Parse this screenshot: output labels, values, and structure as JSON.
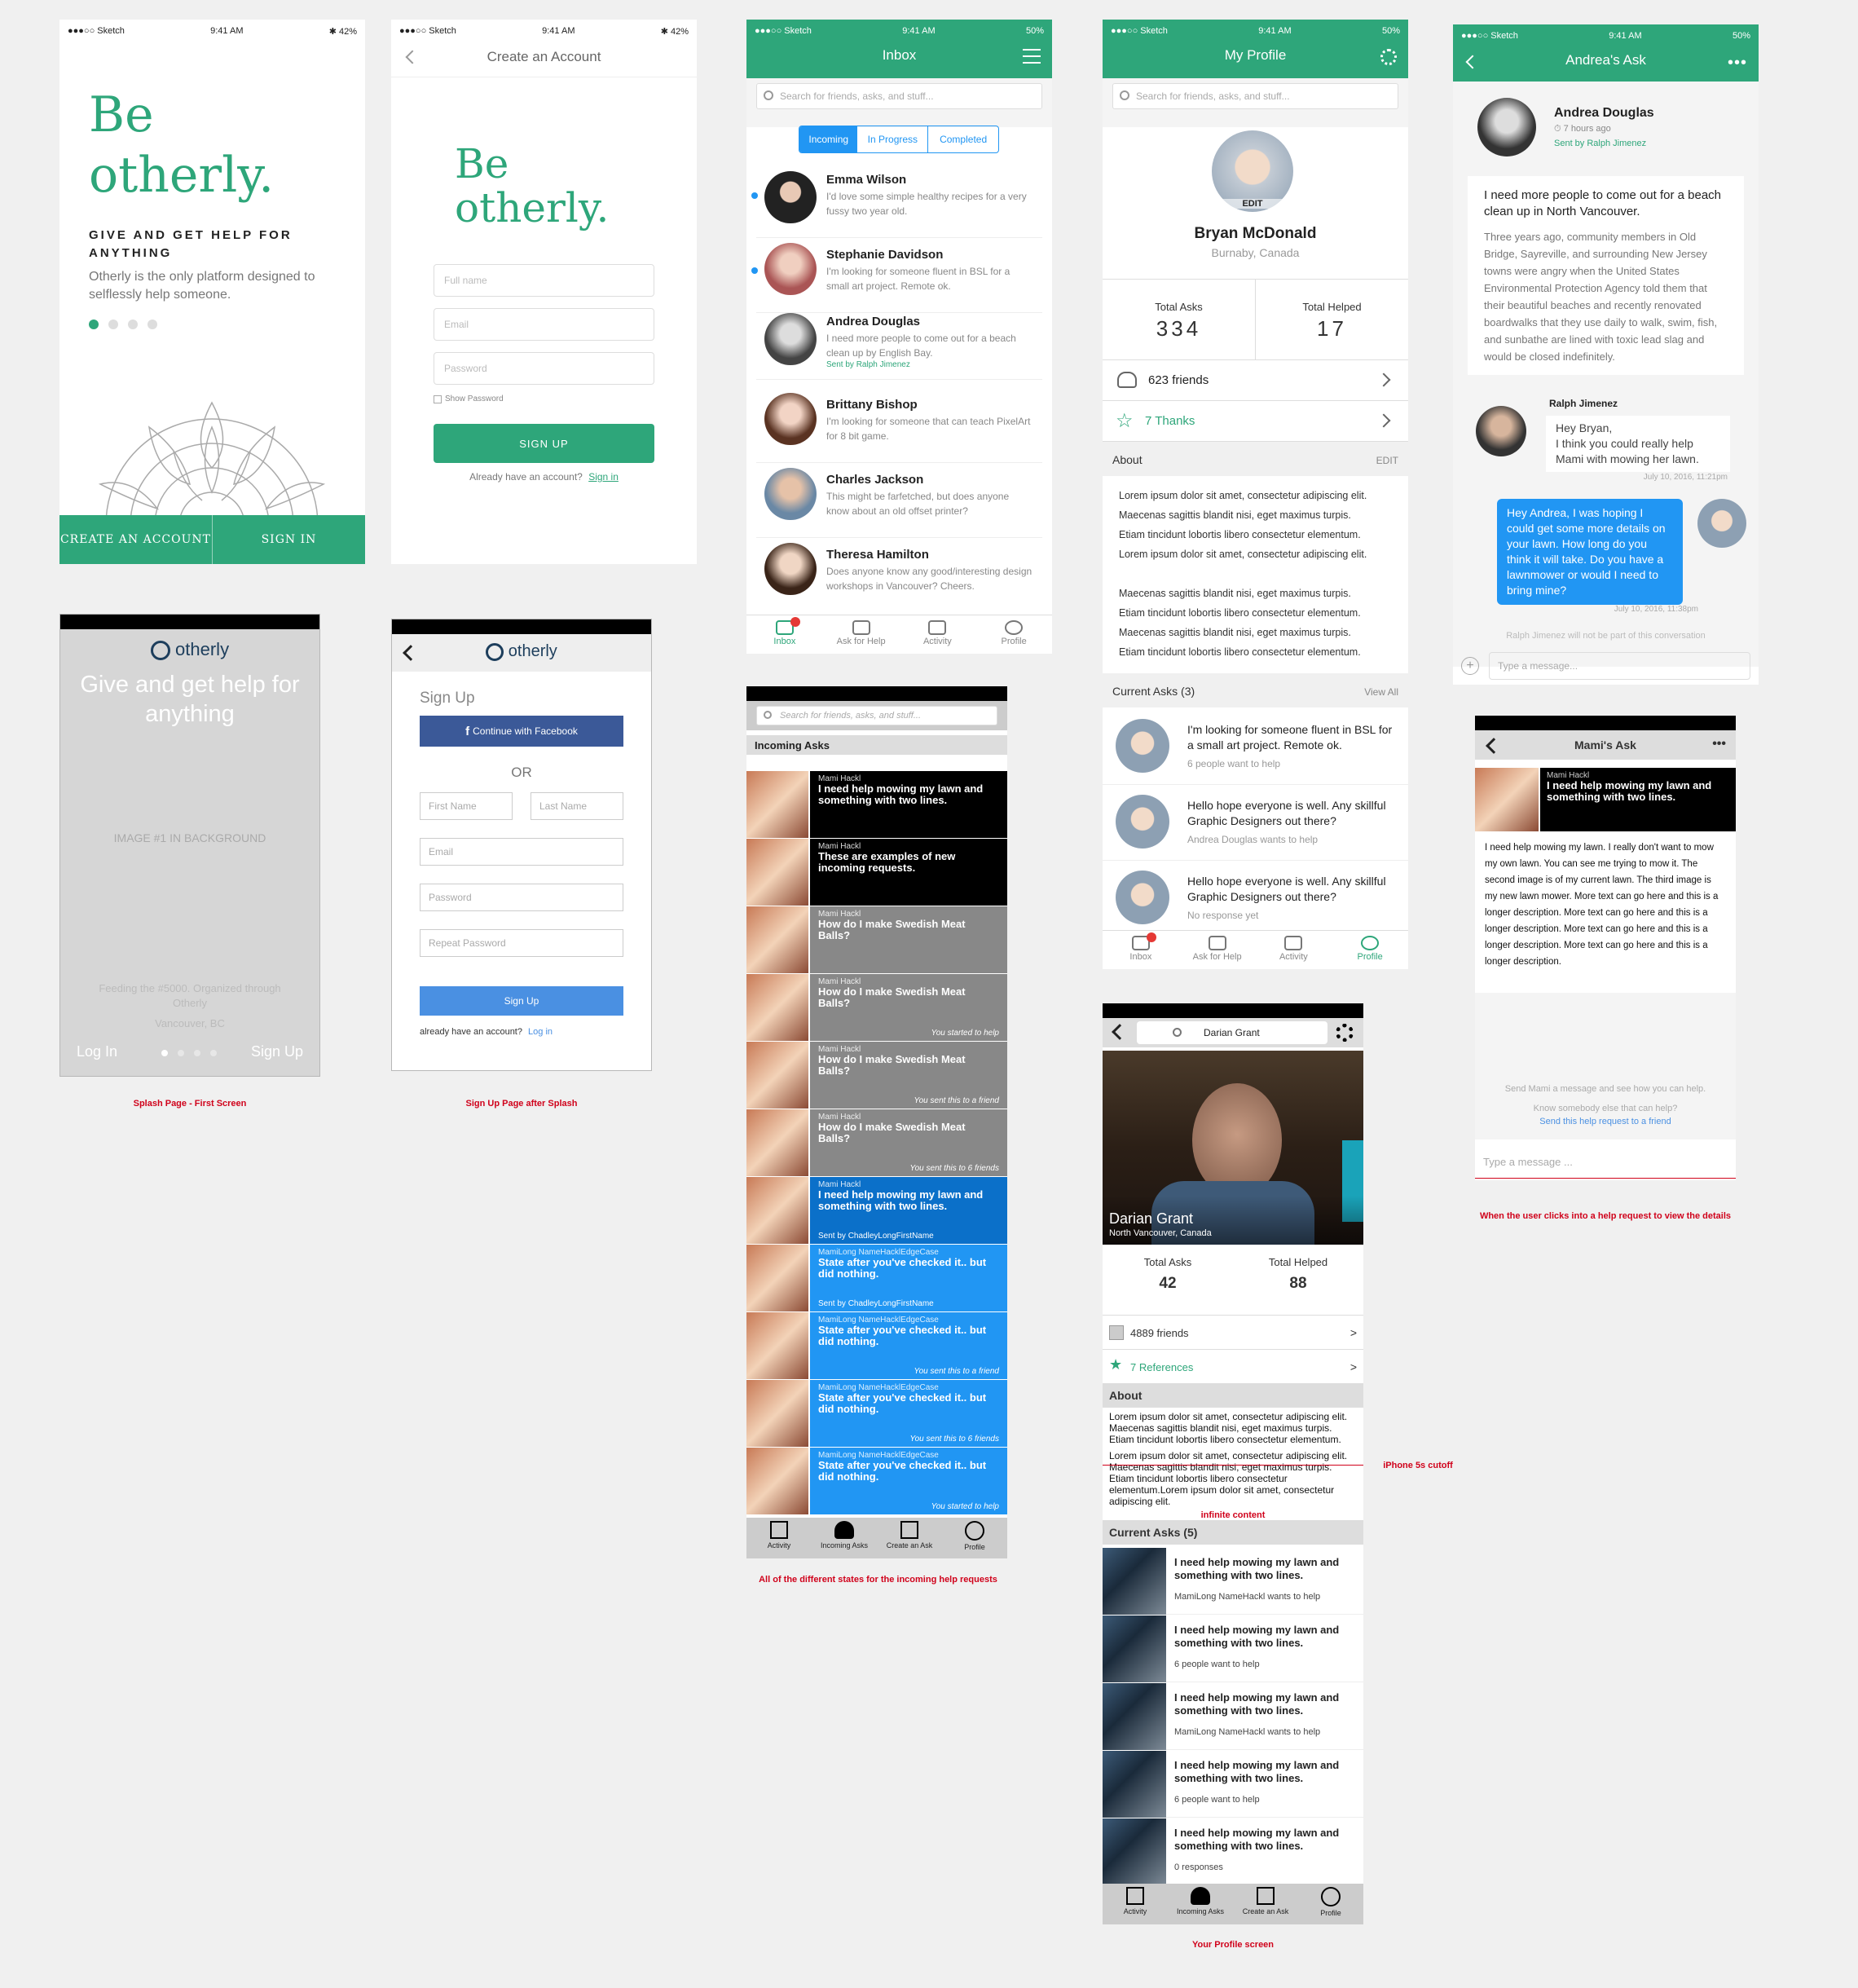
{
  "status": {
    "carrier": "●●●○○ Sketch",
    "time": "9:41 AM",
    "battery": "✱ 42%",
    "battery_alt": "50%"
  },
  "splash": {
    "title_line1": "Be",
    "title_line2": "otherly.",
    "tagline": "GIVE AND GET HELP FOR ANYTHING",
    "description": "Otherly is the only platform designed to selflessly help someone.",
    "create_label": "CREATE AN ACCOUNT",
    "signin_label": "SIGN IN"
  },
  "create_account": {
    "header": "Create an Account",
    "title_line1": "Be",
    "title_line2": "otherly.",
    "fullname_ph": "Full name",
    "email_ph": "Email",
    "password_ph": "Password",
    "show_password": "Show Password",
    "signup_label": "SIGN UP",
    "have_account": "Already have an account?",
    "signin_link": "Sign in"
  },
  "inbox": {
    "title": "Inbox",
    "search_ph": "Search for friends, asks, and stuff...",
    "tabs": [
      "Incoming",
      "In Progress",
      "Completed"
    ],
    "items": [
      {
        "name": "Emma Wilson",
        "text": "I'd love some simple healthy recipes for a very fussy two year old."
      },
      {
        "name": "Stephanie Davidson",
        "text": "I'm looking for someone fluent in BSL for a small art project.  Remote ok."
      },
      {
        "name": "Andrea Douglas",
        "text": "I need more people to come out for a beach clean up by English Bay.",
        "sent": "Sent by Ralph Jimenez"
      },
      {
        "name": "Brittany Bishop",
        "text": "I'm looking for someone that can teach PixelArt for 8 bit game."
      },
      {
        "name": "Charles Jackson",
        "text": "This might be farfetched, but does anyone know about an old offset printer?"
      },
      {
        "name": "Theresa Hamilton",
        "text": "Does anyone know any good/interesting design workshops in Vancouver? Cheers."
      }
    ],
    "tabbar": [
      "Inbox",
      "Ask for Help",
      "Activity",
      "Profile"
    ]
  },
  "profile": {
    "title": "My Profile",
    "search_ph": "Search for friends, asks, and stuff...",
    "edit_badge": "EDIT",
    "name": "Bryan McDonald",
    "location": "Burnaby, Canada",
    "asks_label": "Total Asks",
    "asks": "334",
    "helped_label": "Total Helped",
    "helped": "17",
    "friends": "623 friends",
    "thanks": "7 Thanks",
    "about_label": "About",
    "edit_label": "EDIT",
    "about": [
      "Lorem ipsum dolor sit amet, consectetur adipiscing elit.",
      "Maecenas sagittis blandit nisi, eget maximus turpis.",
      "Etiam tincidunt lobortis libero consectetur elementum.",
      "Lorem ipsum dolor sit amet, consectetur adipiscing elit.",
      "Maecenas sagittis blandit nisi, eget maximus turpis.",
      "Etiam tincidunt lobortis libero consectetur elementum.",
      "Maecenas sagittis blandit nisi, eget maximus turpis.",
      "Etiam tincidunt lobortis libero consectetur elementum."
    ],
    "current_label": "Current Asks (3)",
    "view_all": "View All",
    "asks_list": [
      {
        "q": "I'm looking for someone fluent in BSL for a small art project.  Remote ok.",
        "m": "6 people want to help"
      },
      {
        "q": "Hello hope everyone is well.  Any skillful Graphic Designers out there?",
        "m": "Andrea Douglas wants to help"
      },
      {
        "q": "Hello hope everyone is well.  Any skillful Graphic Designers out there?",
        "m": "No response yet"
      }
    ]
  },
  "ask": {
    "title": "Andrea's Ask",
    "name": "Andrea Douglas",
    "time": "7 hours ago",
    "sent": "Sent by Ralph Jimenez",
    "headline": "I need more people to come out for a beach clean up in North Vancouver.",
    "body": "Three years ago, community members in Old Bridge, Sayreville, and surrounding New Jersey towns were angry when the United States Environmental Protection Agency told them that their beautiful beaches and recently renovated boardwalks that they use daily to walk, swim, fish, and sunbathe are lined with toxic lead slag and would be closed indefinitely.",
    "msg1_name": "Ralph Jimenez",
    "msg1": "Hey Bryan,\nI think you could really help Mami with mowing her lawn.",
    "msg1_time": "July 10, 2016, 11:21pm",
    "msg2": "Hey Andrea, I was hoping I could get some more details on your lawn. How long do you think it will take. Do you have a lawnmower or would I need to bring mine?",
    "msg2_time": "July 10, 2016, 11:38pm",
    "note": "Ralph Jimenez will not be part of this conversation",
    "msg_ph": "Type a message..."
  },
  "wire_splash": {
    "logo": "otherly",
    "headline": "Give and get help for anything",
    "bg": "IMAGE #1 IN BACKGROUND",
    "feeding": "Feeding the #5000. Organized through Otherly",
    "city": "Vancouver, BC",
    "login": "Log In",
    "signup": "Sign Up",
    "caption": "Splash Page - First Screen"
  },
  "wire_signup": {
    "logo": "otherly",
    "title": "Sign Up",
    "facebook": "Continue with Facebook",
    "or": "OR",
    "first": "First Name",
    "last": "Last Name",
    "email": "Email",
    "password": "Password",
    "repeat": "Repeat Password",
    "button": "Sign Up",
    "already": "already have an account?",
    "login": "Log in",
    "caption": "Sign Up Page after Splash"
  },
  "wire_incoming": {
    "search_ph": "Search for friends, asks, and stuff...",
    "section": "Incoming Asks",
    "rows": [
      {
        "name": "Mami Hackl",
        "q": "I need help mowing my lawn and something with two lines.",
        "status": "",
        "sent": ""
      },
      {
        "name": "Mami Hackl",
        "q": "These are examples of new incoming requests.",
        "status": "",
        "sent": ""
      },
      {
        "name": "Mami Hackl",
        "q": "How do I make Swedish Meat Balls?",
        "status": "",
        "sent": ""
      },
      {
        "name": "Mami Hackl",
        "q": "How do I make Swedish Meat Balls?",
        "status": "You started to help",
        "sent": ""
      },
      {
        "name": "Mami Hackl",
        "q": "How do I make Swedish Meat Balls?",
        "status": "You sent this to a friend",
        "sent": ""
      },
      {
        "name": "Mami Hackl",
        "q": "How do I make Swedish Meat Balls?",
        "status": "You sent this to 6 friends",
        "sent": ""
      },
      {
        "name": "Mami Hackl",
        "q": "I need help mowing my lawn and something with two lines.",
        "status": "",
        "sent": "Sent by ChadleyLongFirstName"
      },
      {
        "name": "MamiLong NameHacklEdgeCase",
        "q": "State after you've checked it.. but did nothing.",
        "status": "",
        "sent": "Sent by ChadleyLongFirstName"
      },
      {
        "name": "MamiLong NameHacklEdgeCase",
        "q": "State after you've checked it.. but did nothing.",
        "status": "You sent this to a friend",
        "sent": ""
      },
      {
        "name": "MamiLong NameHacklEdgeCase",
        "q": "State after you've checked it.. but did nothing.",
        "status": "You sent this to 6 friends",
        "sent": ""
      },
      {
        "name": "MamiLong NameHacklEdgeCase",
        "q": "State after you've checked it.. but did nothing.",
        "status": "You started to help",
        "sent": ""
      }
    ],
    "tabs": [
      "Activity",
      "Incoming Asks",
      "Create an Ask",
      "Profile"
    ],
    "caption": "All of the different states for the incoming help requests"
  },
  "wire_profile": {
    "search": "Darian Grant",
    "name": "Darian Grant",
    "location": "North Vancouver, Canada",
    "asks_label": "Total Asks",
    "asks": "42",
    "helped_label": "Total Helped",
    "helped": "88",
    "friends": "4889 friends",
    "refs": "7 References",
    "arrow": ">",
    "about_label": "About",
    "about1": "Lorem ipsum dolor sit amet, consectetur adipiscing elit. Maecenas sagittis blandit nisi, eget maximus turpis. Etiam tincidunt lobortis libero consectetur elementum.",
    "about2": "Lorem ipsum dolor sit amet, consectetur adipiscing elit. Maecenas sagittis blandit nisi, eget maximus turpis. Etiam tincidunt lobortis libero consectetur elementum.Lorem ipsum dolor sit amet, consectetur adipiscing elit.",
    "infinite": "infinite content",
    "cutoff": "iPhone 5s cutoff",
    "current_label": "Current Asks (5)",
    "asks_list": [
      {
        "q": "I need help mowing my lawn and something with two lines.",
        "m": "MamiLong NameHackl wants to help"
      },
      {
        "q": "I need help mowing my lawn and something with two lines.",
        "m": "6 people want to help"
      },
      {
        "q": "I need help mowing my lawn and something with two lines.",
        "m": "MamiLong NameHackl wants to help"
      },
      {
        "q": "I need help mowing my lawn and something with two lines.",
        "m": "6 people want to help"
      },
      {
        "q": "I need help mowing my lawn and something with two lines.",
        "m": "0 responses"
      }
    ],
    "tabs": [
      "Activity",
      "Incoming Asks",
      "Create an Ask",
      "Profile"
    ],
    "caption": "Your Profile screen"
  },
  "wire_ask": {
    "title": "Mami's Ask",
    "name": "Mami Hackl",
    "q": "I need help mowing my lawn and something with two lines.",
    "body": "I need help mowing my lawn. I really don't want to mow my own lawn. You can see me trying to mow it. The second image is of my current lawn.  The third image is my new lawn mower. More text can go here and this is a longer description. More text can go here and this is a longer description. More text can go here and this is a longer description. More text can go here and this is a longer description.",
    "send": "Send Mami a message and see how you can help.",
    "know": "Know somebody else that can help?",
    "send_link": "Send this help request to a friend",
    "msg_ph": "Type a message ...",
    "caption": "When the user clicks into a help request to view the details"
  },
  "colors": {
    "accent": "#2ea67a",
    "blue": "#2196f3",
    "red": "#d0021b"
  }
}
